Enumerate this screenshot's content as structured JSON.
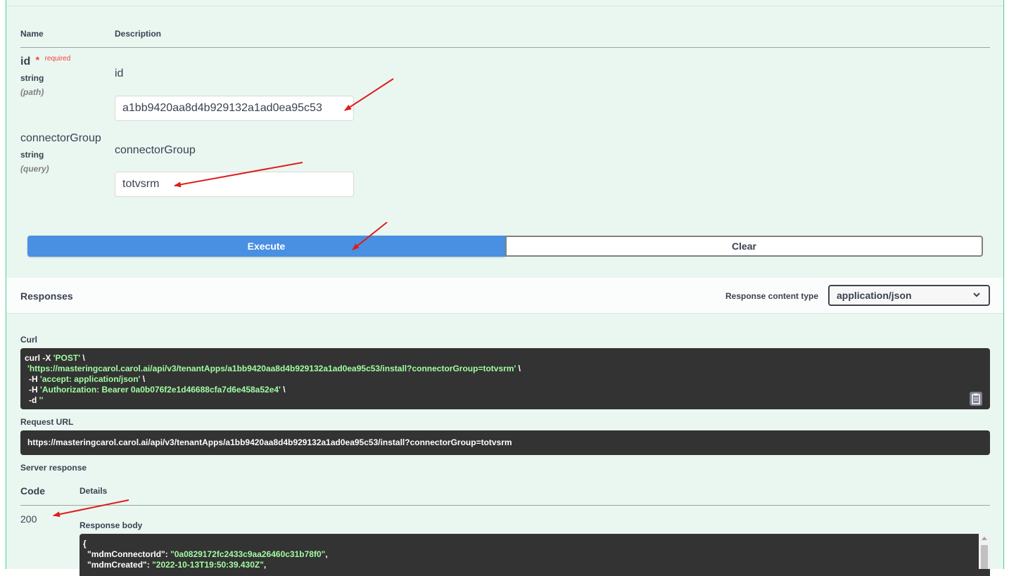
{
  "params_table": {
    "header_name": "Name",
    "header_description": "Description",
    "params": [
      {
        "name": "id",
        "required_star": "*",
        "required_label": "required",
        "type": "string",
        "in": "(path)",
        "description": "id",
        "value": "a1bb9420aa8d4b929132a1ad0ea95c53"
      },
      {
        "name": "connectorGroup",
        "type": "string",
        "in": "(query)",
        "description": "connectorGroup",
        "value": "totvsrm"
      }
    ]
  },
  "actions": {
    "execute_label": "Execute",
    "clear_label": "Clear"
  },
  "responses": {
    "title": "Responses",
    "content_type_label": "Response content type",
    "content_type_value": "application/json"
  },
  "curl": {
    "label": "Curl",
    "l1_cmd": "curl -X ",
    "l1_str": "'POST'",
    "l1_tail": " \\",
    "l2_str": "'https://masteringcarol.carol.ai/api/v3/tenantApps/a1bb9420aa8d4b929132a1ad0ea95c53/install?connectorGroup=totvsrm'",
    "l2_tail": " \\",
    "l3_cmd": "-H ",
    "l3_str": "'accept: application/json'",
    "l3_tail": " \\",
    "l4_cmd": "-H ",
    "l4_str": "'Authorization: Bearer 0a0b076f2e1d46688cfa7d6e458a52e4'",
    "l4_tail": " \\",
    "l5_cmd": "-d ",
    "l5_str": "''"
  },
  "request_url": {
    "label": "Request URL",
    "value": "https://masteringcarol.carol.ai/api/v3/tenantApps/a1bb9420aa8d4b929132a1ad0ea95c53/install?connectorGroup=totvsrm"
  },
  "server_response": {
    "label": "Server response",
    "code_header": "Code",
    "details_header": "Details",
    "code": "200",
    "body_label": "Response body",
    "body_l1": "{",
    "body_l2_key": "\"mdmConnectorId\"",
    "body_l2_val": "\"0a0829172fc2433c9aa26460c31b78f0\"",
    "body_l3_key": "\"mdmCreated\"",
    "body_l3_val": "\"2022-10-13T19:50:39.430Z\""
  },
  "colors": {
    "panel_bg": "#eaf7f1",
    "panel_border": "#49cc90",
    "execute_bg": "#4990e2",
    "code_bg": "#333333",
    "string_green": "#a2fca2",
    "required_red": "#f93e3e",
    "annotation_arrow": "#e11b1b"
  }
}
